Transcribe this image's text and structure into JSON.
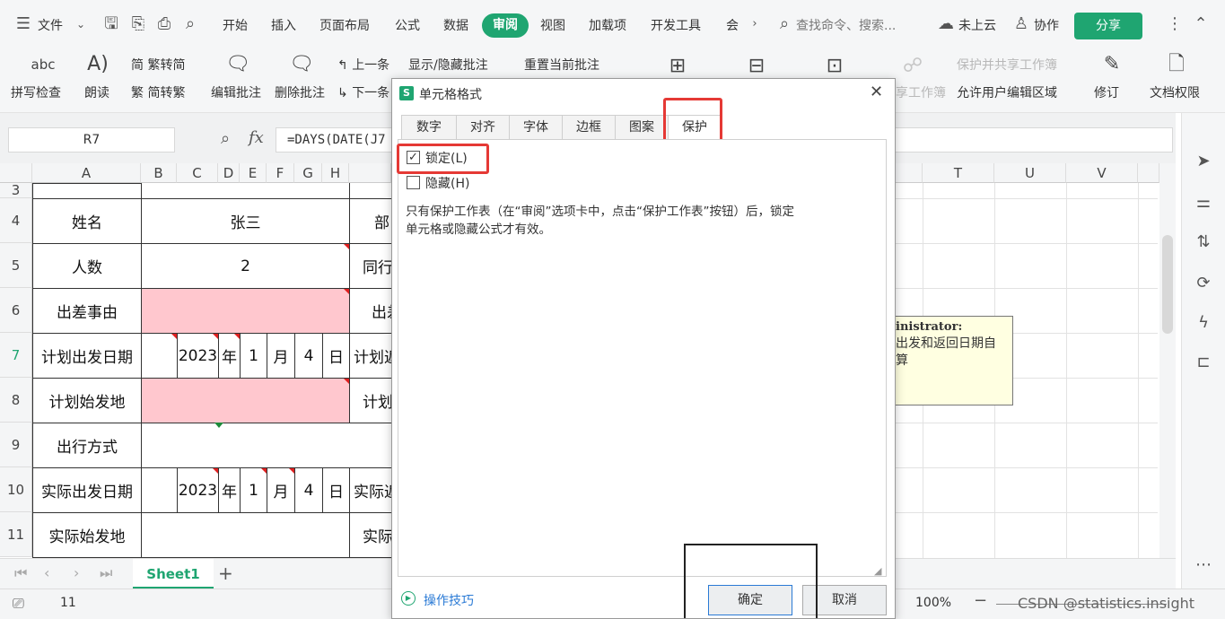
{
  "menubar": {
    "file": "文件",
    "tabs": [
      "开始",
      "插入",
      "页面布局",
      "公式",
      "数据",
      "审阅",
      "视图",
      "加载项",
      "开发工具",
      "会"
    ],
    "active_tab": "审阅",
    "search": "查找命令、搜索...",
    "cloud": "未上云",
    "collab": "协作",
    "share": "分享"
  },
  "ribbon": {
    "spell": "拼写检查",
    "read": "朗读",
    "t2s": "繁转简",
    "s2t": "简转繁",
    "edit_comment": "编辑批注",
    "delete_comment": "删除批注",
    "prev": "上一条",
    "next": "下一条",
    "show_hide": "显示/隐藏批注",
    "reset_comment": "重置当前批注",
    "protect_share": "保护并共享工作簿",
    "protect_wb_partial": "享工作簿",
    "allow_edit": "允许用户编辑区域",
    "revise": "修订",
    "doc_rights": "文档权限"
  },
  "formula_bar": {
    "name_box": "R7",
    "fx": "fx",
    "formula": "=DAYS(DATE(J7"
  },
  "sheet": {
    "columns": [
      "A",
      "B",
      "C",
      "D",
      "E",
      "F",
      "G",
      "H",
      "T",
      "U",
      "V"
    ],
    "rows": [
      "3",
      "4",
      "5",
      "6",
      "7",
      "8",
      "9",
      "10",
      "11"
    ],
    "cells": {
      "a4": "姓名",
      "b4": "张三",
      "i4": "部",
      "a5": "人数",
      "b5": "2",
      "i5": "同行",
      "a6": "出差事由",
      "i6": "出差",
      "a7": "计划出发日期",
      "c7": "2023",
      "d7": "年",
      "e7": "1",
      "f7": "月",
      "g7": "4",
      "h7": "日",
      "i7": "计划返",
      "a8": "计划始发地",
      "i8": "计划",
      "a9": "出行方式",
      "a10": "实际出发日期",
      "c10": "2023",
      "d10": "年",
      "e10": "1",
      "f10": "月",
      "g10": "4",
      "h10": "日",
      "i10": "实际返",
      "a11": "实际始发地",
      "i11": "实际"
    },
    "comment": {
      "author": "inistrator:",
      "line1": "出发和返回日期自",
      "line2": "算"
    }
  },
  "sheet_tabs": {
    "active": "Sheet1",
    "add": "+"
  },
  "status": {
    "count": "11",
    "zoom": "100%",
    "watermark": "CSDN @statistics.insight"
  },
  "dialog": {
    "title": "单元格格式",
    "tabs": [
      "数字",
      "对齐",
      "字体",
      "边框",
      "图案",
      "保护"
    ],
    "active_tab": "保护",
    "locked_label": "锁定(L)",
    "locked_checked": true,
    "hidden_label": "隐藏(H)",
    "hidden_checked": false,
    "note_line1": "只有保护工作表（在“审阅”选项卡中，点击“保护工作表”按钮）后，锁定",
    "note_line2": "单元格或隐藏公式才有效。",
    "tips": "操作技巧",
    "ok": "确定",
    "cancel": "取消"
  }
}
